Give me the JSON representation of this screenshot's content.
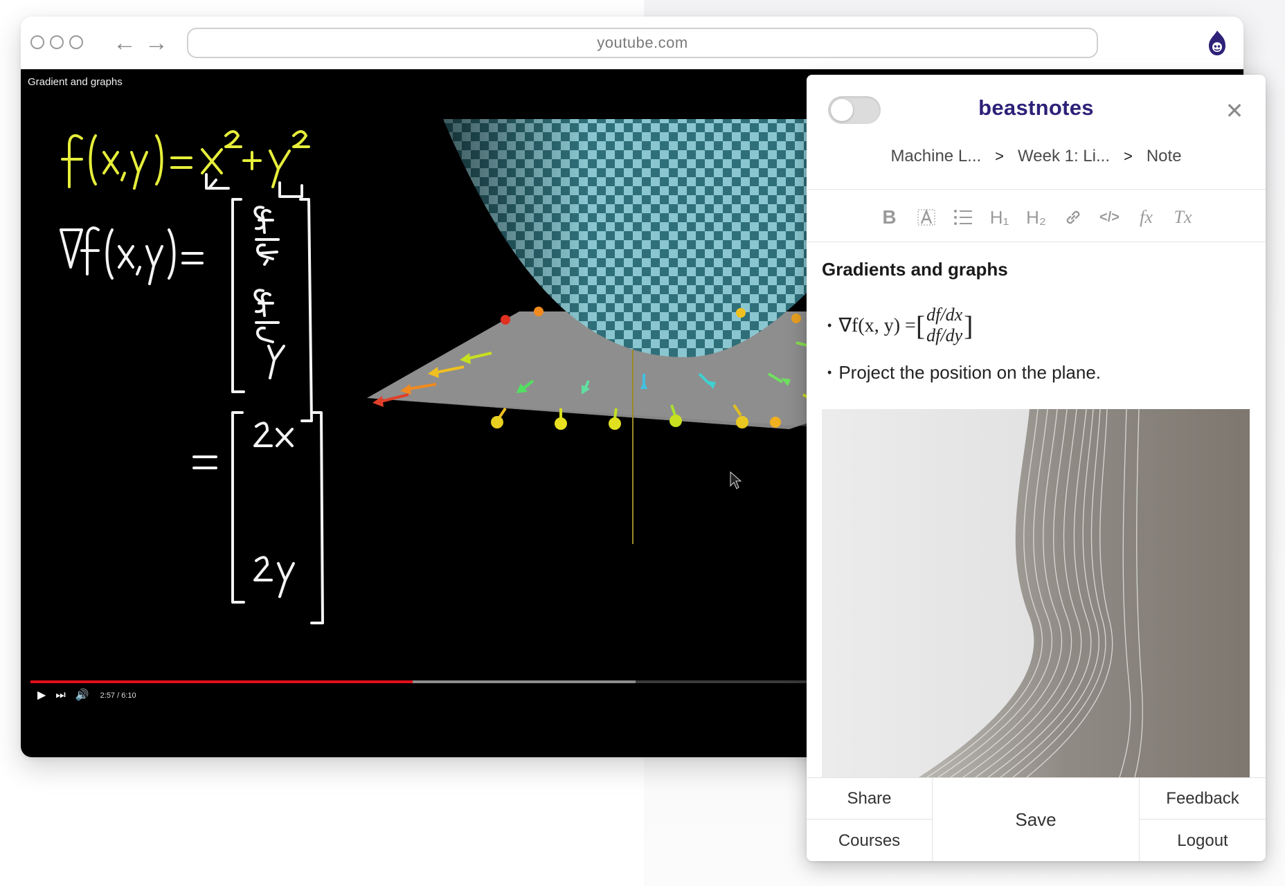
{
  "browser": {
    "url": "youtube.com",
    "extension_icon": "beast-flame-icon"
  },
  "video": {
    "title": "Gradient and graphs",
    "timecode": "2:57 / 6:10",
    "progress": 0.48,
    "buffered": 0.76,
    "icons": [
      "play-icon",
      "next-icon",
      "volume-icon"
    ]
  },
  "panel": {
    "brand": "beastnotes",
    "toggle_on": false,
    "breadcrumb": [
      "Machine L...",
      "Week 1: Li...",
      "Note"
    ],
    "breadcrumb_sep": ">",
    "toolbar": [
      {
        "name": "bold",
        "glyph": "B"
      },
      {
        "name": "highlight",
        "glyph": "A"
      },
      {
        "name": "bullet-list",
        "glyph": "☰"
      },
      {
        "name": "heading-1",
        "glyph": "H₁"
      },
      {
        "name": "heading-2",
        "glyph": "H₂"
      },
      {
        "name": "link",
        "glyph": "🔗"
      },
      {
        "name": "code",
        "glyph": "</>"
      },
      {
        "name": "formula",
        "glyph": "fx"
      },
      {
        "name": "clear-format",
        "glyph": "Tx"
      }
    ],
    "note": {
      "title": "Gradients and graphs",
      "formula_lhs": "∇f(x, y) =",
      "formula_top": "df/dx",
      "formula_bottom": "df/dy",
      "bullet2": "Project the position on the plane."
    },
    "footer": {
      "share": "Share",
      "courses": "Courses",
      "save": "Save",
      "feedback": "Feedback",
      "logout": "Logout"
    },
    "accent": "#2d2178"
  }
}
